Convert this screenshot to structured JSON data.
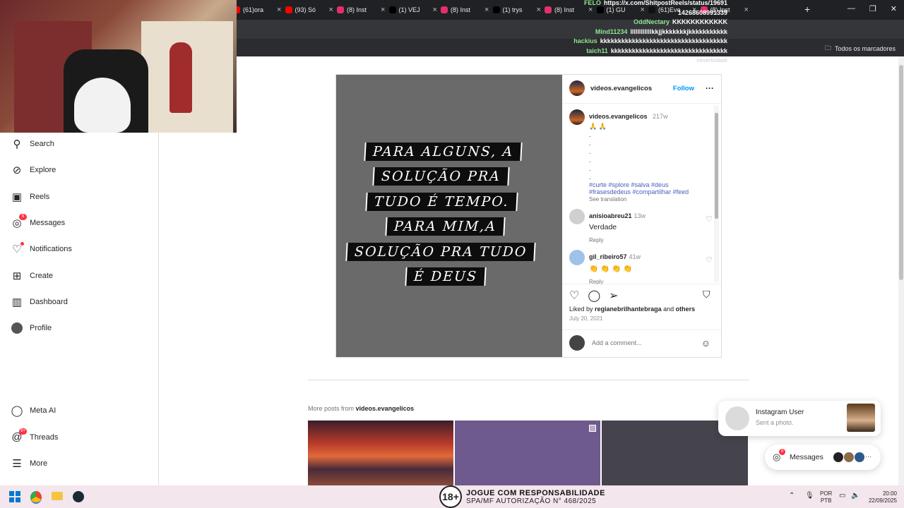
{
  "browser": {
    "tabs": [
      {
        "label": "(61)ora",
        "color": "#ff0000"
      },
      {
        "label": "(93) Só",
        "color": "#ff0000"
      },
      {
        "label": "(8) Inst",
        "color": "#e1306c"
      },
      {
        "label": "(1) VEJ",
        "color": "#000000"
      },
      {
        "label": "(8) Inst",
        "color": "#e1306c"
      },
      {
        "label": "(1) trys",
        "color": "#000000"
      },
      {
        "label": "(8) Inst",
        "color": "#e1306c"
      },
      {
        "label": "(1) GU",
        "color": "#000000"
      },
      {
        "label": "(61)Eve",
        "color": "#111111"
      },
      {
        "label": "(8) Inst",
        "color": "#e1306c"
      }
    ],
    "bookmarks_label": "Todos os marcadores"
  },
  "chat": [
    {
      "user": "FELO",
      "message": "https://x.com/ShitpostReels/status/19691"
    },
    {
      "user": "",
      "message": "14268608991339"
    },
    {
      "user": "OddNectary",
      "message": "KKKKKKKKKKKK"
    },
    {
      "user": "Mind11234",
      "message": "llllllllllllkkjjkkkkkkkjkkkkkkkkkkk"
    },
    {
      "user": "hackius",
      "message": "kkkkkkkkkkkkkkkkkkkkkkkkkkkkkkkkkkkk"
    },
    {
      "user": "taich11",
      "message": "kkkkkkkkkkkkkkkkkkkkkkkkkkkkkkkkk"
    },
    {
      "user": "",
      "message": "nevertsolate"
    }
  ],
  "sidebar": {
    "items": [
      {
        "label": "Search",
        "icon": "search-icon"
      },
      {
        "label": "Explore",
        "icon": "compass-icon"
      },
      {
        "label": "Reels",
        "icon": "reels-icon"
      },
      {
        "label": "Messages",
        "icon": "messenger-icon",
        "badge": "8"
      },
      {
        "label": "Notifications",
        "icon": "heart-icon"
      },
      {
        "label": "Create",
        "icon": "plus-square-icon"
      },
      {
        "label": "Dashboard",
        "icon": "dashboard-icon"
      },
      {
        "label": "Profile",
        "icon": "profile-avatar"
      }
    ],
    "bottom_items": [
      {
        "label": "Meta AI",
        "icon": "meta-ai-icon"
      },
      {
        "label": "Threads",
        "icon": "threads-icon",
        "badge": "9+"
      },
      {
        "label": "More",
        "icon": "menu-icon"
      }
    ]
  },
  "post": {
    "image_lines": [
      "PARA ALGUNS, A",
      "SOLUÇÃO  PRA",
      "TUDO É TEMPO.",
      "PARA MIM,A",
      "SOLUÇÃO PRA TUDO",
      "É DEUS"
    ],
    "author": "videos.evangelicos",
    "follow_label": "Follow",
    "caption_time": "217w",
    "caption_emojis": "🙏 🙏",
    "caption_dots": [
      ".",
      ".",
      ".",
      ".",
      ".",
      "."
    ],
    "hashtags_line1": "#curte #splore #salva #deus",
    "hashtags_line2": "#frasesdedeus #compartilhar #feed",
    "see_translation": "See translation",
    "comments": [
      {
        "user": "anisioabreu21",
        "time": "13w",
        "text": "Verdade",
        "reply": "Reply"
      },
      {
        "user": "gil_ribeiro57",
        "time": "41w",
        "text": "👏 👏 👏 👏",
        "reply": "Reply"
      }
    ],
    "liked_by_prefix": "Liked by",
    "liked_by_user": "regianebrilhantebraga",
    "liked_by_and": "and",
    "liked_by_others": "others",
    "date": "July 20, 2021",
    "comment_placeholder": "Add a comment..."
  },
  "more_posts": {
    "prefix": "More posts from",
    "author": "videos.evangelicos"
  },
  "notification": {
    "title": "Instagram User",
    "subtitle": "Sent a photo."
  },
  "messages_pill": {
    "label": "Messages",
    "badge": "8",
    "more": "···"
  },
  "taskbar": {
    "ad_badge": "18+",
    "ad_line1": "JOGUE COM RESPONSABILIDADE",
    "ad_line2": "SPA/MF AUTORIZAÇÃO N° 468/2025",
    "lang1": "POR",
    "lang2": "PTB",
    "time": "20:00",
    "date": "22/09/2025"
  }
}
